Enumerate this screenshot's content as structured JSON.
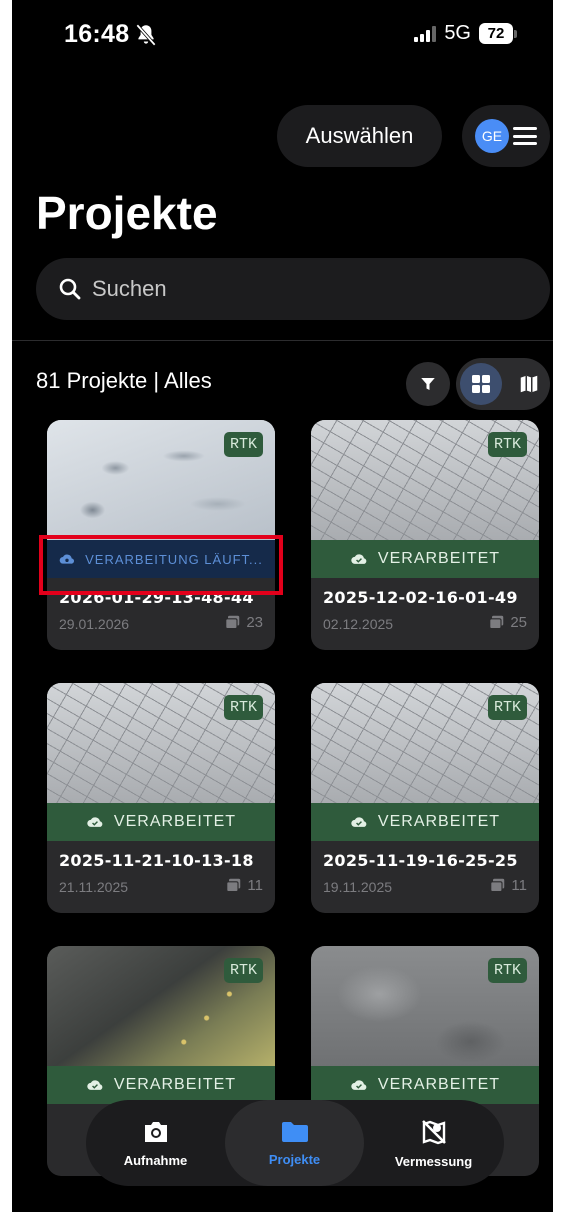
{
  "status_bar": {
    "time": "16:48",
    "network": "5G",
    "battery": "72"
  },
  "header": {
    "select_label": "Auswählen",
    "avatar_initials": "GE",
    "title": "Projekte"
  },
  "search": {
    "placeholder": "Suchen"
  },
  "summary": {
    "text": "81 Projekte | Alles"
  },
  "cards": [
    {
      "badge": "RTK",
      "status": "VERARBEITUNG LÄUFT...",
      "status_kind": "processing",
      "name": "2026-01-29-13-48-44",
      "date": "29.01.2026",
      "count": "23"
    },
    {
      "badge": "RTK",
      "status": "VERARBEITET",
      "status_kind": "done",
      "name": "2025-12-02-16-01-49",
      "date": "02.12.2025",
      "count": "25"
    },
    {
      "badge": "RTK",
      "status": "VERARBEITET",
      "status_kind": "done",
      "name": "2025-11-21-10-13-18",
      "date": "21.11.2025",
      "count": "11"
    },
    {
      "badge": "RTK",
      "status": "VERARBEITET",
      "status_kind": "done",
      "name": "2025-11-19-16-25-25",
      "date": "19.11.2025",
      "count": "11"
    },
    {
      "badge": "RTK",
      "status": "VERARBEITET",
      "status_kind": "done"
    },
    {
      "badge": "RTK",
      "status": "VERARBEITET",
      "status_kind": "done"
    }
  ],
  "nav": [
    {
      "label": "Aufnahme",
      "icon": "camera-icon"
    },
    {
      "label": "Projekte",
      "icon": "folder-icon",
      "active": true
    },
    {
      "label": "Vermessung",
      "icon": "map-pin-off-icon"
    }
  ],
  "colors": {
    "accent": "#3f8ef5",
    "done": "#2f5b3c",
    "processing": "#152a4a",
    "highlight": "#e3001b"
  }
}
